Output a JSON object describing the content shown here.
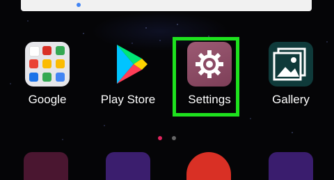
{
  "home": {
    "apps": [
      {
        "label": "Google"
      },
      {
        "label": "Play Store"
      },
      {
        "label": "Settings"
      },
      {
        "label": "Gallery"
      }
    ]
  },
  "highlighted_app": "Settings",
  "colors": {
    "highlight": "#1ee21e",
    "settings_bg": "#8a4964",
    "gallery_bg": "#0f3a3a",
    "page_dot_active": "#e0245e"
  },
  "page_indicator": {
    "pages": 2,
    "active": 1
  },
  "icons": [
    "search-bar",
    "google-folder-icon",
    "play-store-icon",
    "settings-gear-icon",
    "gallery-icon"
  ]
}
